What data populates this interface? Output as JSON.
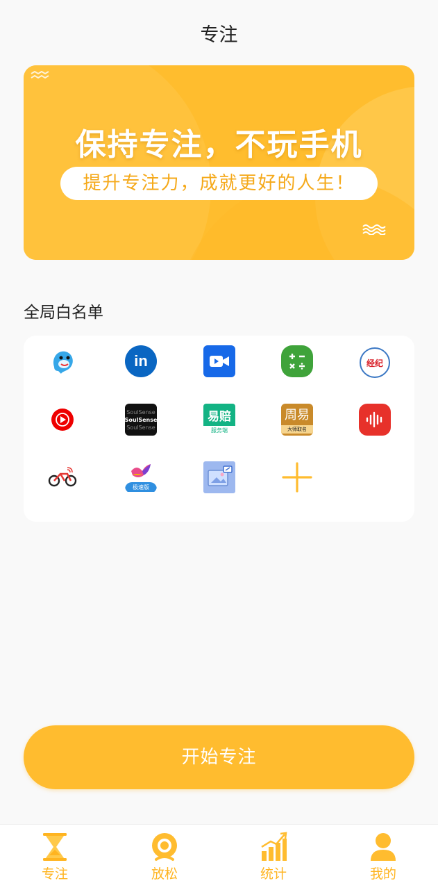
{
  "page": {
    "title": "专注"
  },
  "banner": {
    "headline": "保持专注，不玩手机",
    "subline": "提升专注力，成就更好的人生！",
    "color": "#ffbd2e"
  },
  "whitelist": {
    "section_title": "全局白名单",
    "apps": [
      {
        "icon": "dolphin-app-icon"
      },
      {
        "icon": "linkedin-app-icon",
        "text": "in"
      },
      {
        "icon": "video-meeting-app-icon"
      },
      {
        "icon": "calculator-app-icon"
      },
      {
        "icon": "badge-app-icon",
        "text": "经纪"
      },
      {
        "icon": "youtube-music-app-icon"
      },
      {
        "icon": "soulsense-app-icon",
        "text": "SoulSense"
      },
      {
        "icon": "yipei-app-icon",
        "text": "易赔",
        "subtext": "服务端"
      },
      {
        "icon": "zhouyi-app-icon",
        "text": "周易",
        "subtext": "大师取名"
      },
      {
        "icon": "voice-recorder-app-icon"
      },
      {
        "icon": "bike-app-icon"
      },
      {
        "icon": "bird-app-icon",
        "subtext": "极速版"
      },
      {
        "icon": "gallery-app-icon"
      },
      {
        "icon": "add-icon"
      }
    ]
  },
  "start_button": {
    "label": "开始专注"
  },
  "tabbar": {
    "active_color": "#ffb420",
    "items": [
      {
        "label": "专注",
        "icon": "hourglass-icon"
      },
      {
        "label": "放松",
        "icon": "camera-icon"
      },
      {
        "label": "统计",
        "icon": "bar-chart-icon"
      },
      {
        "label": "我的",
        "icon": "user-icon"
      }
    ]
  }
}
